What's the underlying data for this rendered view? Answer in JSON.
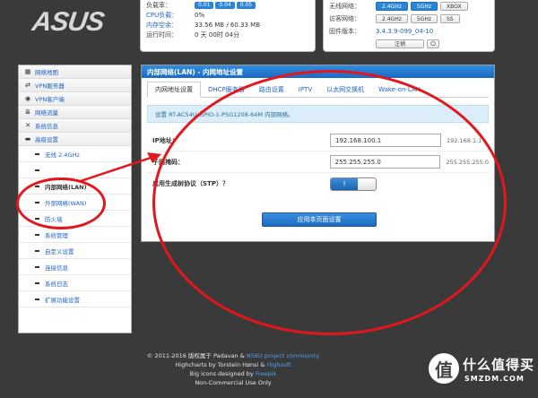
{
  "brand": {
    "logo": "ASUS"
  },
  "status_left": {
    "rows": [
      {
        "label": "负载率：",
        "badges": [
          "0.01",
          "0.04",
          "0.05"
        ]
      },
      {
        "label": "CPU负载：",
        "value": "0%"
      },
      {
        "label": "内存空余：",
        "value": "33.56 MB / 60.33 MB"
      },
      {
        "label": "运行时间：",
        "value": "0 天 00时 04分"
      }
    ]
  },
  "status_right": {
    "row0_label": "无线网络：",
    "row0_buttons": [
      "2.4GHz",
      "5GHz",
      "XBOX"
    ],
    "row1_label": "访客网络：",
    "row1_buttons": [
      "2.4GHz",
      "5GHz",
      "SS"
    ],
    "row2_label": "固件版本：",
    "row2_value": "3.4.3.9-099_04-10",
    "logout_label": "注销",
    "power_icon": "power-icon"
  },
  "sidebar": {
    "items": [
      {
        "label": "网络地图",
        "icon": "grid-icon"
      },
      {
        "label": "VPN服务器",
        "icon": "arrows-icon"
      },
      {
        "label": "VPN客户端",
        "icon": "globe-icon"
      },
      {
        "label": "网络流量",
        "icon": "list-icon"
      },
      {
        "label": "系统信息",
        "icon": "shuffle-icon"
      },
      {
        "label": "高级设置",
        "icon": "folder-icon"
      }
    ],
    "subitems": [
      "无线 2.4GHz",
      "",
      "内部网络(LAN)",
      "外部网络(WAN)",
      "防火墙",
      "系统管理",
      "自定义设置",
      "连接信息",
      "系统日志",
      "扩展功能设置"
    ]
  },
  "panel": {
    "title": "内部网络(LAN) - 内网地址设置",
    "tabs": [
      "内网地址设置",
      "DHCP服务器",
      "路由设置",
      "IPTV",
      "以太网交换机",
      "Wake-on-LAN"
    ],
    "info": "设置 RT-AC54U-GPIO-1-PSG1208-64M 内部网络。",
    "ip_label": "IP地址：",
    "ip_value": "192.168.100.1",
    "ip_hint": "192.168.1.1",
    "mask_label": "子网掩码：",
    "mask_value": "255.255.255.0",
    "mask_hint": "255.255.255.0",
    "stp_label": "启用生成树协议（STP）？",
    "stp_on": "I",
    "apply_label": "应用本页面设置"
  },
  "footer": {
    "line1_pre": "© 2011-2016 版权属于 Padavan & ",
    "line1_link": "N56U project community",
    "line2_pre": "Highcharts by Torstein Hønsi & ",
    "line2_link": "Highsoft",
    "line3_pre": "Big icons designed by ",
    "line3_link": "Freepik",
    "line4": "Non-Commercial Use Only"
  },
  "watermark": {
    "badge": "值",
    "text": "什么值得买",
    "sub": "SMZDM.COM"
  },
  "colors": {
    "accent": "#1b6ac0",
    "annotation": "#e3161d",
    "link": "#1e63c4"
  }
}
